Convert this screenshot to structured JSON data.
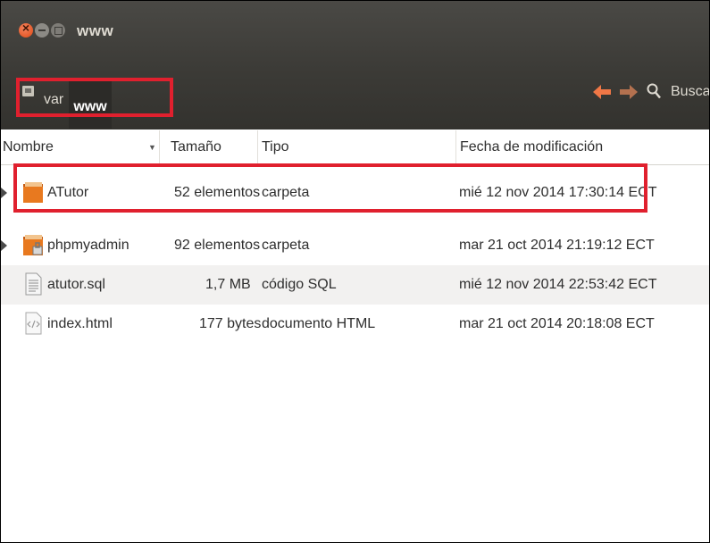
{
  "window": {
    "title": "www",
    "highlight_color": "#e0202e"
  },
  "toolbar": {
    "breadcrumb": [
      "var",
      "www"
    ],
    "search_label": "Buscar",
    "icons": [
      "back-arrow-icon",
      "forward-arrow-icon",
      "search-icon"
    ]
  },
  "columns": {
    "name": "Nombre",
    "size": "Tamaño",
    "type": "Tipo",
    "modified": "Fecha de modificación"
  },
  "files": [
    {
      "name": "ATutor",
      "size": "52 elementos",
      "type": "carpeta",
      "modified": "mié 12 nov 2014 17:30:14 ECT",
      "icon": "folder-icon"
    },
    {
      "name": "phpmyadmin",
      "size": "92 elementos",
      "type": "carpeta",
      "modified": "mar 21 oct 2014 21:19:12 ECT",
      "icon": "locked-folder-icon"
    },
    {
      "name": "atutor.sql",
      "size": "1,7 MB",
      "type": "código SQL",
      "modified": "mié 12 nov 2014 22:53:42 ECT",
      "icon": "text-file-icon"
    },
    {
      "name": "index.html",
      "size": "177 bytes",
      "type": "documento HTML",
      "modified": "mar 21 oct 2014 20:18:08 ECT",
      "icon": "html-file-icon"
    }
  ]
}
